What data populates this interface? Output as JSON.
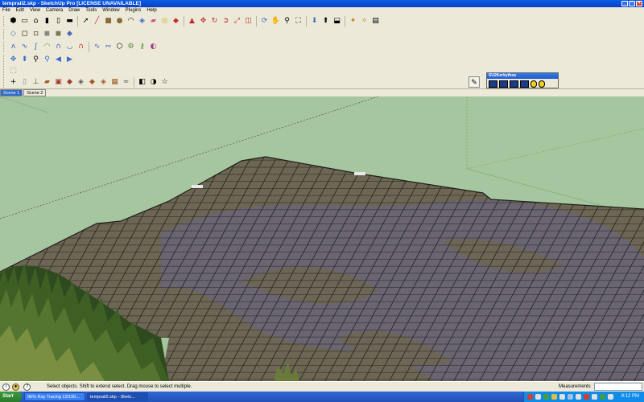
{
  "window": {
    "title": "temprail2.skp - SketchUp Pro [LICENSE UNAVAILABLE]"
  },
  "menu": [
    "File",
    "Edit",
    "View",
    "Camera",
    "Draw",
    "Tools",
    "Window",
    "Plugins",
    "Help"
  ],
  "scenes": [
    "Scene 1",
    "Scene 2"
  ],
  "palette": {
    "title": "SU2Kerkythea"
  },
  "status": {
    "hint": "Select objects. Shift to extend select. Drag mouse to select multiple.",
    "measurements_label": "Measurements",
    "measurements_value": ""
  },
  "taskbar": {
    "start": "Start",
    "tasks": [
      "96% Ray Tracing 13/100...",
      "temprail2.skp - Sketc..."
    ],
    "clock": "9:12 PM"
  },
  "colors": {
    "sky": "#a3c59c",
    "paving": "#6f6755",
    "grass": "#2c4a1c",
    "accent": "#316ac5"
  }
}
